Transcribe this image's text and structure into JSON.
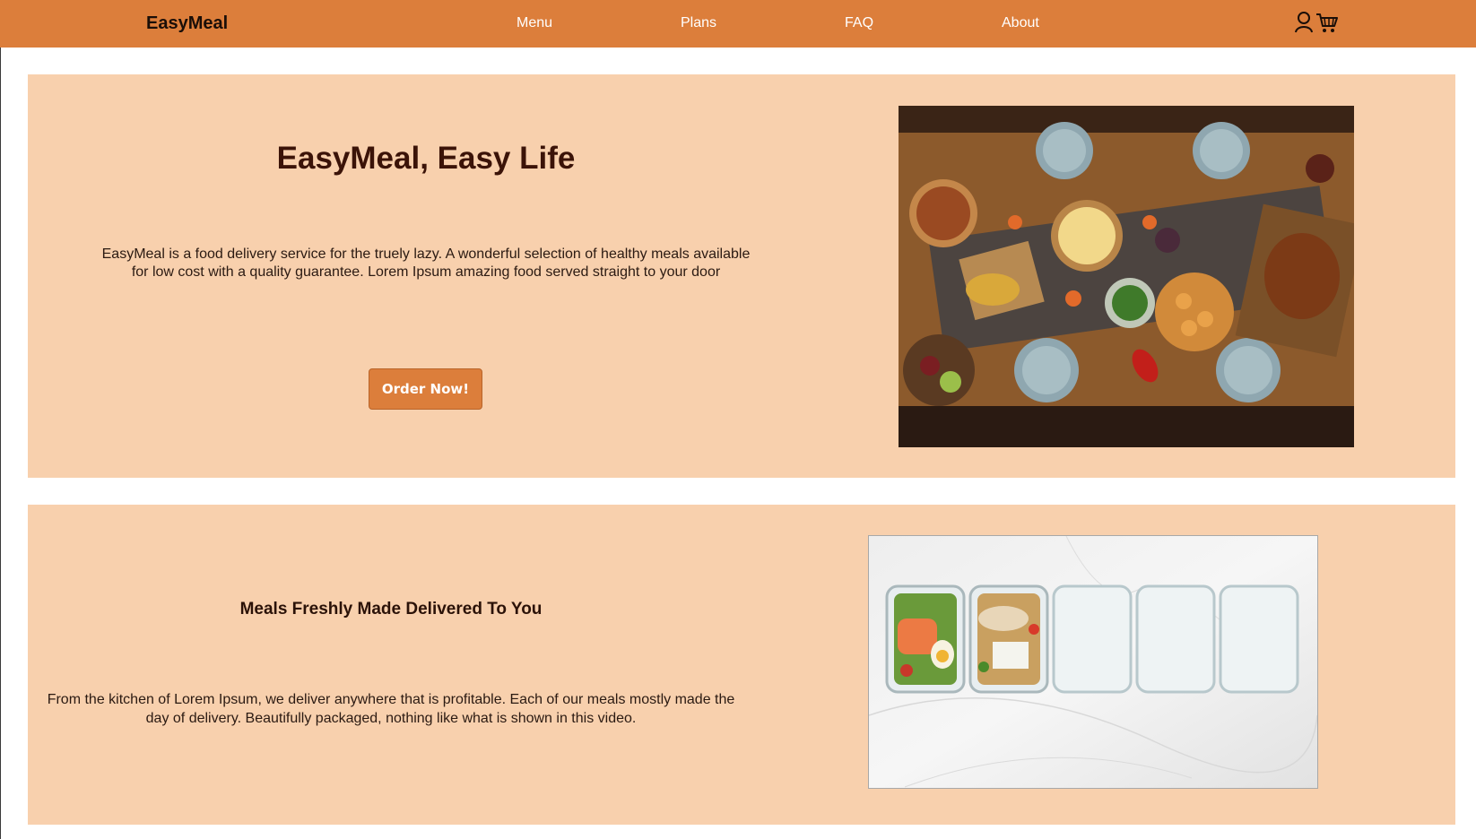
{
  "navbar": {
    "brand": "EasyMeal",
    "links": [
      "Menu",
      "Plans",
      "FAQ",
      "About"
    ],
    "icons": [
      "user-icon",
      "cart-icon"
    ],
    "color": "#dc7e3b"
  },
  "hero": {
    "title": "EasyMeal, Easy Life",
    "description": "EasyMeal is a food delivery service for the truely lazy. A wonderful selection of healthy meals available for low cost with a quality guarantee. Lorem Ipsum amazing food served straight to your door",
    "cta_label": "Order Now!",
    "background": "#f8d0ad"
  },
  "fresh": {
    "title": "Meals Freshly Made Delivered To You",
    "description": "From the kitchen of Lorem Ipsum, we deliver anywhere that is profitable. Each of our meals mostly made the day of delivery. Beautifully packaged, nothing like what is shown in this video."
  }
}
